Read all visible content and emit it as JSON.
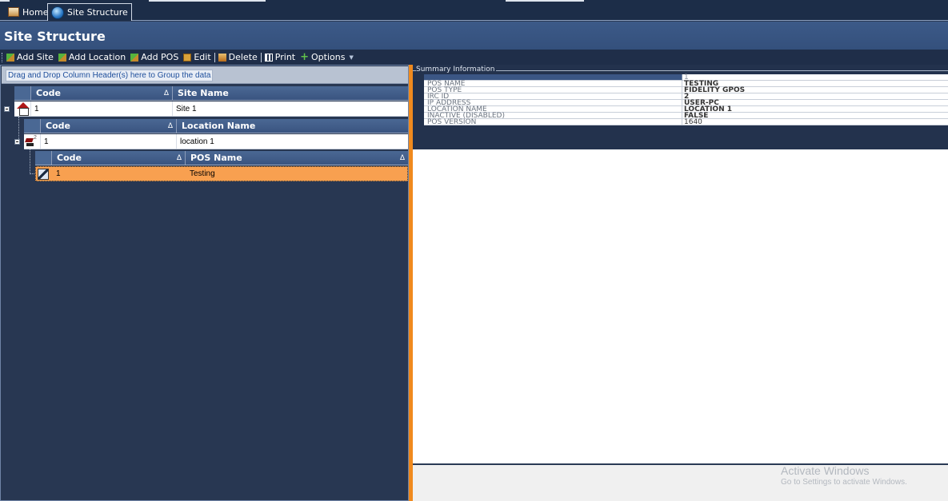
{
  "tabs": [
    {
      "label": "Home",
      "icon": "home-icon"
    },
    {
      "label": "Site Structure",
      "icon": "globe-icon"
    }
  ],
  "page_title": "Site Structure",
  "toolbar": {
    "add_site": "Add Site",
    "add_location": "Add Location",
    "add_pos": "Add POS",
    "edit": "Edit",
    "delete": "Delete",
    "print": "Print",
    "options": "Options"
  },
  "grid": {
    "group_hint": "Drag and Drop Column Header(s) here to Group the data",
    "sites": {
      "columns": {
        "code": "Code",
        "name": "Site Name"
      },
      "row": {
        "code": "1",
        "name": "Site 1"
      }
    },
    "locations": {
      "columns": {
        "code": "Code",
        "name": "Location Name"
      },
      "row": {
        "code": "1",
        "name": "location 1",
        "badge": "2"
      }
    },
    "pos": {
      "columns": {
        "code": "Code",
        "name": "POS Name"
      },
      "row": {
        "code": "1",
        "name": "Testing"
      }
    }
  },
  "summary": {
    "legend": "Summary Information",
    "header_value": "1",
    "rows": [
      {
        "key": "POS NAME",
        "value": "TESTING"
      },
      {
        "key": "POS TYPE",
        "value": "FIDELITY GPOS"
      },
      {
        "key": "IRC ID",
        "value": "2"
      },
      {
        "key": "IP ADDRESS",
        "value": "USER-PC"
      },
      {
        "key": "LOCATION NAME",
        "value": "LOCATION 1"
      },
      {
        "key": "INACTIVE (DISABLED)",
        "value": "FALSE"
      },
      {
        "key": "POS VERSION",
        "value": "1640"
      }
    ]
  },
  "watermark": {
    "line1": "Activate Windows",
    "line2": "Go to Settings to activate Windows."
  },
  "colors": {
    "accent": "#f08a1e",
    "selected_row": "#f8a050",
    "header": "#3c5a88"
  }
}
